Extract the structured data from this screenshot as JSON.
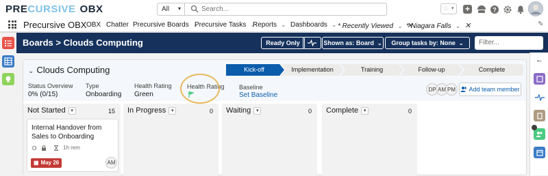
{
  "global_header": {
    "logo_part1": "PRE",
    "logo_part2": "CURSIVE",
    "logo_part3": "OBX",
    "search_scope": "All",
    "search_placeholder": "Search..."
  },
  "nav": {
    "app_name": "Precursive OBX",
    "items": [
      {
        "label": "OBX"
      },
      {
        "label": "Chatter"
      },
      {
        "label": "Precursive Boards"
      },
      {
        "label": "Precursive Tasks"
      },
      {
        "label": "Reports"
      },
      {
        "label": "Dashboards"
      },
      {
        "label": "* Recently Viewed"
      },
      {
        "label": "* Niagara Falls"
      }
    ]
  },
  "toolbar": {
    "breadcrumb": "Boards > Clouds Computing",
    "ready_only": "Ready Only",
    "shown_as": "Shown as: Board",
    "group_by": "Group tasks by: None",
    "filter_placeholder": "Filter..."
  },
  "project": {
    "title": "Clouds Computing",
    "path_steps": [
      "Kick-off",
      "Implementation",
      "Training",
      "Follow-up",
      "Complete"
    ],
    "active_step": "Kick-off",
    "metrics": {
      "status_overview_label": "Status Overview",
      "status_overview_value": "0% (0/15)",
      "type_label": "Type",
      "type_value": "Onboarding",
      "health_label": "Health Rating",
      "health_value": "Green",
      "health_flag_label": "Health Rating",
      "baseline_label": "Baseline",
      "baseline_value": "Set Baseline"
    },
    "team": [
      "DP",
      "AM",
      "PM"
    ],
    "add_team_member": "Add team member"
  },
  "columns": [
    {
      "title": "Not Started",
      "count": "15"
    },
    {
      "title": "In Progress",
      "count": "0"
    },
    {
      "title": "Waiting",
      "count": "0"
    },
    {
      "title": "Complete",
      "count": "0"
    }
  ],
  "card": {
    "title": "Internal Handover from Sales to Onboarding",
    "effort": "1h rem",
    "due_date": "May 26",
    "assignee": "AM"
  },
  "colors": {
    "brand_dark": "#16325c",
    "accent_blue": "#0b5cab",
    "highlight_ring": "#e8b95d",
    "health_flag": "#4bca81",
    "date_badge": "#c23934"
  }
}
